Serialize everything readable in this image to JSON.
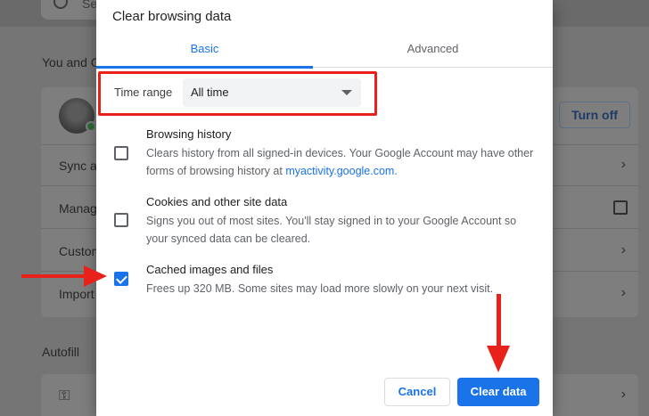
{
  "background": {
    "search_placeholder": "Se",
    "section_you": "You and G",
    "turn_off_label": "Turn off",
    "rows": [
      "Sync ar",
      "Manag",
      "Custom",
      "Import"
    ],
    "section_autofill": "Autofill"
  },
  "dialog": {
    "title": "Clear browsing data",
    "tabs": [
      {
        "label": "Basic",
        "selected": true
      },
      {
        "label": "Advanced",
        "selected": false
      }
    ],
    "time_range": {
      "label": "Time range",
      "value": "All time"
    },
    "options": [
      {
        "title": "Browsing history",
        "desc_before_link": "Clears history from all signed-in devices. Your Google Account may have other forms of browsing history at ",
        "link": "myactivity.google.com",
        "desc_after_link": ".",
        "checked": false
      },
      {
        "title": "Cookies and other site data",
        "desc": "Signs you out of most sites. You'll stay signed in to your Google Account so your synced data can be cleared.",
        "checked": false
      },
      {
        "title": "Cached images and files",
        "desc": "Frees up 320 MB. Some sites may load more slowly on your next visit.",
        "checked": true
      }
    ],
    "cancel_label": "Cancel",
    "clear_label": "Clear data"
  },
  "colors": {
    "accent": "#1a73e8",
    "annotation": "#e8221b"
  }
}
